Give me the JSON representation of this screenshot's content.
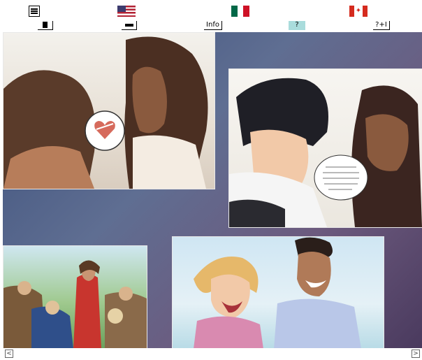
{
  "toolbar": {
    "menu_icon": "hamburger-menu-icon",
    "flags": [
      {
        "name": "us-flag",
        "colors": [
          "#b22234",
          "#ffffff",
          "#3c3b6e"
        ]
      },
      {
        "name": "mexico-flag",
        "colors": [
          "#006847",
          "#ffffff",
          "#ce1126"
        ]
      },
      {
        "name": "canada-flag",
        "colors": [
          "#d52b1e",
          "#ffffff",
          "#d52b1e"
        ]
      }
    ],
    "buttons": {
      "info_label": "Info",
      "help_label": "?",
      "help_plus_label": "?+I"
    },
    "help_highlight_color": "#a9dcdc"
  },
  "viewer": {
    "panels": [
      {
        "name": "comic-panel-heart-bubble"
      },
      {
        "name": "comic-panel-crying-girl"
      },
      {
        "name": "illustration-jesus-crowd"
      },
      {
        "name": "illustration-happy-couple"
      }
    ]
  },
  "nav": {
    "prev_label": "<",
    "next_label": ">"
  }
}
